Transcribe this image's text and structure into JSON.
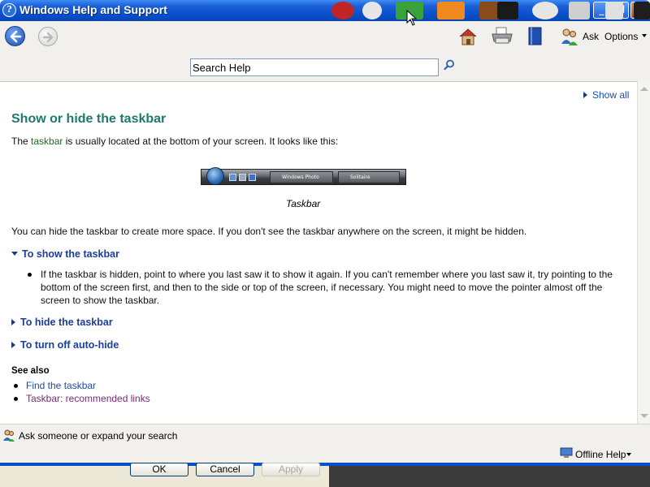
{
  "window": {
    "title": "Windows Help and Support",
    "minimize": "_",
    "maximize": "❐",
    "close": "✕"
  },
  "toolbar": {
    "back_icon": "back-arrow-icon",
    "forward_icon": "forward-arrow-icon",
    "ask_label": "Ask",
    "options_label": "Options",
    "search_value": "Search Help"
  },
  "content": {
    "show_all": "Show all",
    "title": "Show or hide the taskbar",
    "intro_pre": "The ",
    "intro_term": "taskbar",
    "intro_post": " is usually located at the bottom of your screen. It looks like this:",
    "taskbar_image": {
      "task1": "Windows Photo Gall...",
      "task2": "Solitaire"
    },
    "caption": "Taskbar",
    "paragraph": "You can hide the taskbar to create more space. If you don't see the taskbar anywhere on the screen, it might be hidden.",
    "sections": {
      "show": "To show the taskbar",
      "show_bullet": "If the taskbar is hidden, point to where you last saw it to show it again. If you can't remember where you last saw it, try pointing to the bottom of the screen first, and then to the side or top of the screen, if necessary. You might need to move the pointer almost off the screen to show the taskbar.",
      "hide": "To hide the taskbar",
      "auto_hide": "To turn off auto-hide"
    },
    "see_also": {
      "heading": "See also",
      "links": [
        "Find the taskbar",
        "Taskbar: recommended links"
      ]
    }
  },
  "bottom": {
    "ask_text": "Ask someone or expand your search",
    "offline_help": "Offline Help"
  },
  "dialog": {
    "ok": "OK",
    "cancel": "Cancel",
    "apply": "Apply"
  }
}
